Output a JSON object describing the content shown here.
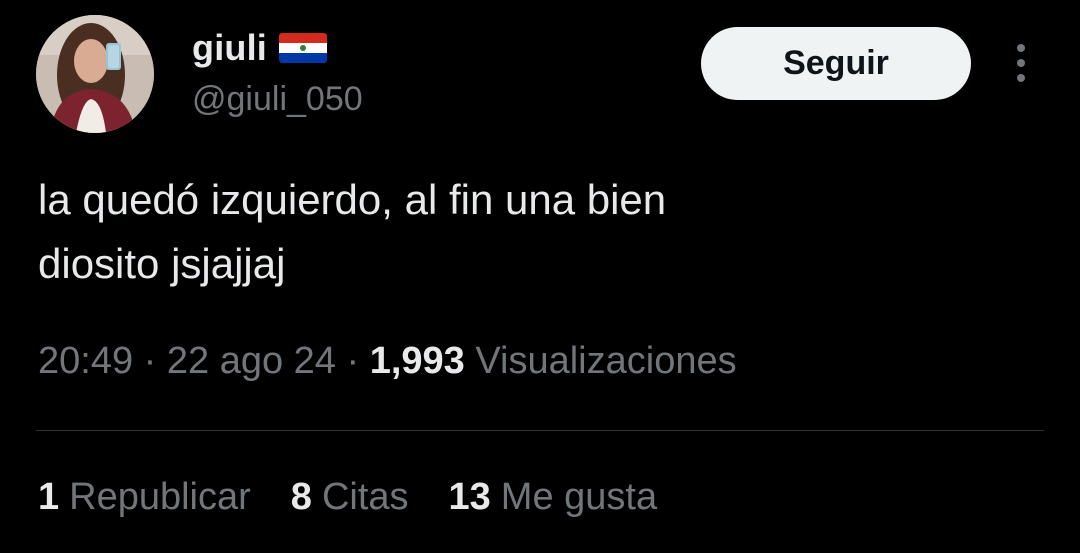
{
  "author": {
    "display_name": "giuli",
    "handle": "@giuli_050",
    "flag_icon": "paraguay-flag-icon",
    "avatar_icon": "profile-photo-avatar"
  },
  "follow_button": {
    "label": "Seguir"
  },
  "more_icon": "more-vertical-icon",
  "tweet": {
    "text_lines": [
      "la quedó izquierdo, al fin una bien",
      "diosito jsjajjaj"
    ],
    "time": "20:49",
    "separator": "·",
    "date": "22 ago 24",
    "views_count": "1,993",
    "views_label": "Visualizaciones"
  },
  "stats": [
    {
      "count": "1",
      "label": "Republicar"
    },
    {
      "count": "8",
      "label": "Citas"
    },
    {
      "count": "13",
      "label": "Me gusta"
    }
  ],
  "colors": {
    "background": "#000000",
    "primary_text": "#e7e9ea",
    "secondary_text": "#71767b",
    "button_background": "#eff3f4",
    "divider": "#2f3336"
  }
}
